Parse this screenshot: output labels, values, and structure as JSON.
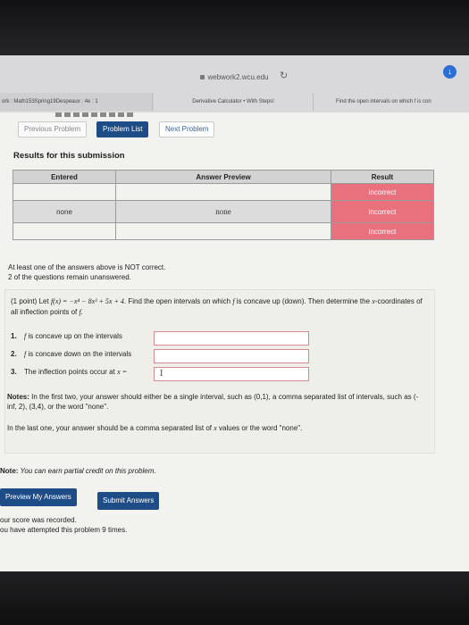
{
  "browser": {
    "url": "webwork2.wcu.edu",
    "tabs": [
      "ork : Math153Spring19Despeaux : 4e : 1",
      "Derivative Calculator • With Steps!",
      "Find the open intervals on which f is con"
    ]
  },
  "nav": {
    "previous": "Previous Problem",
    "list": "Problem List",
    "next": "Next Problem"
  },
  "results": {
    "title": "Results for this submission",
    "headers": [
      "Entered",
      "Answer Preview",
      "Result"
    ],
    "rows": [
      {
        "entered": "",
        "preview": "",
        "result": "incorrect"
      },
      {
        "entered": "none",
        "preview": "none",
        "result": "incorrect"
      },
      {
        "entered": "",
        "preview": "",
        "result": "incorrect"
      }
    ]
  },
  "status": {
    "line1": "At least one of the answers above is NOT correct.",
    "line2": "2 of the questions remain unanswered."
  },
  "problem": {
    "points": "(1 point)",
    "text_a": "Let",
    "function": "f(x) = −x⁴ − 8x³ + 5x + 4",
    "text_b": ". Find the open intervals on which",
    "f": "f",
    "text_c": "is concave up (down). Then determine the",
    "xvar": "x",
    "text_d": "-coordinates of all inflection points of",
    "end": "f."
  },
  "questions": [
    {
      "num": "1.",
      "f": "f",
      "label": "is concave up on the intervals"
    },
    {
      "num": "2.",
      "f": "f",
      "label": "is concave down on the intervals"
    },
    {
      "num": "3.",
      "label": "The inflection points occur at",
      "x": "x ="
    }
  ],
  "notes": {
    "prefix": "Notes:",
    "text": "In the first two, your answer should either be a single interval, such as (0,1), a comma separated list of intervals, such as (-inf, 2), (3,4), or the word \"none\".",
    "text2_a": "In the last one, your answer should be a comma separated list of",
    "text2_x": "x",
    "text2_b": "values or the word \"none\"."
  },
  "partial": {
    "prefix": "Note:",
    "text": "You can earn partial credit on this problem."
  },
  "buttons": {
    "preview": "Preview My Answers",
    "submit": "Submit Answers"
  },
  "footer": {
    "line1": "our score was recorded.",
    "line2": "ou have attempted this problem 9 times."
  }
}
